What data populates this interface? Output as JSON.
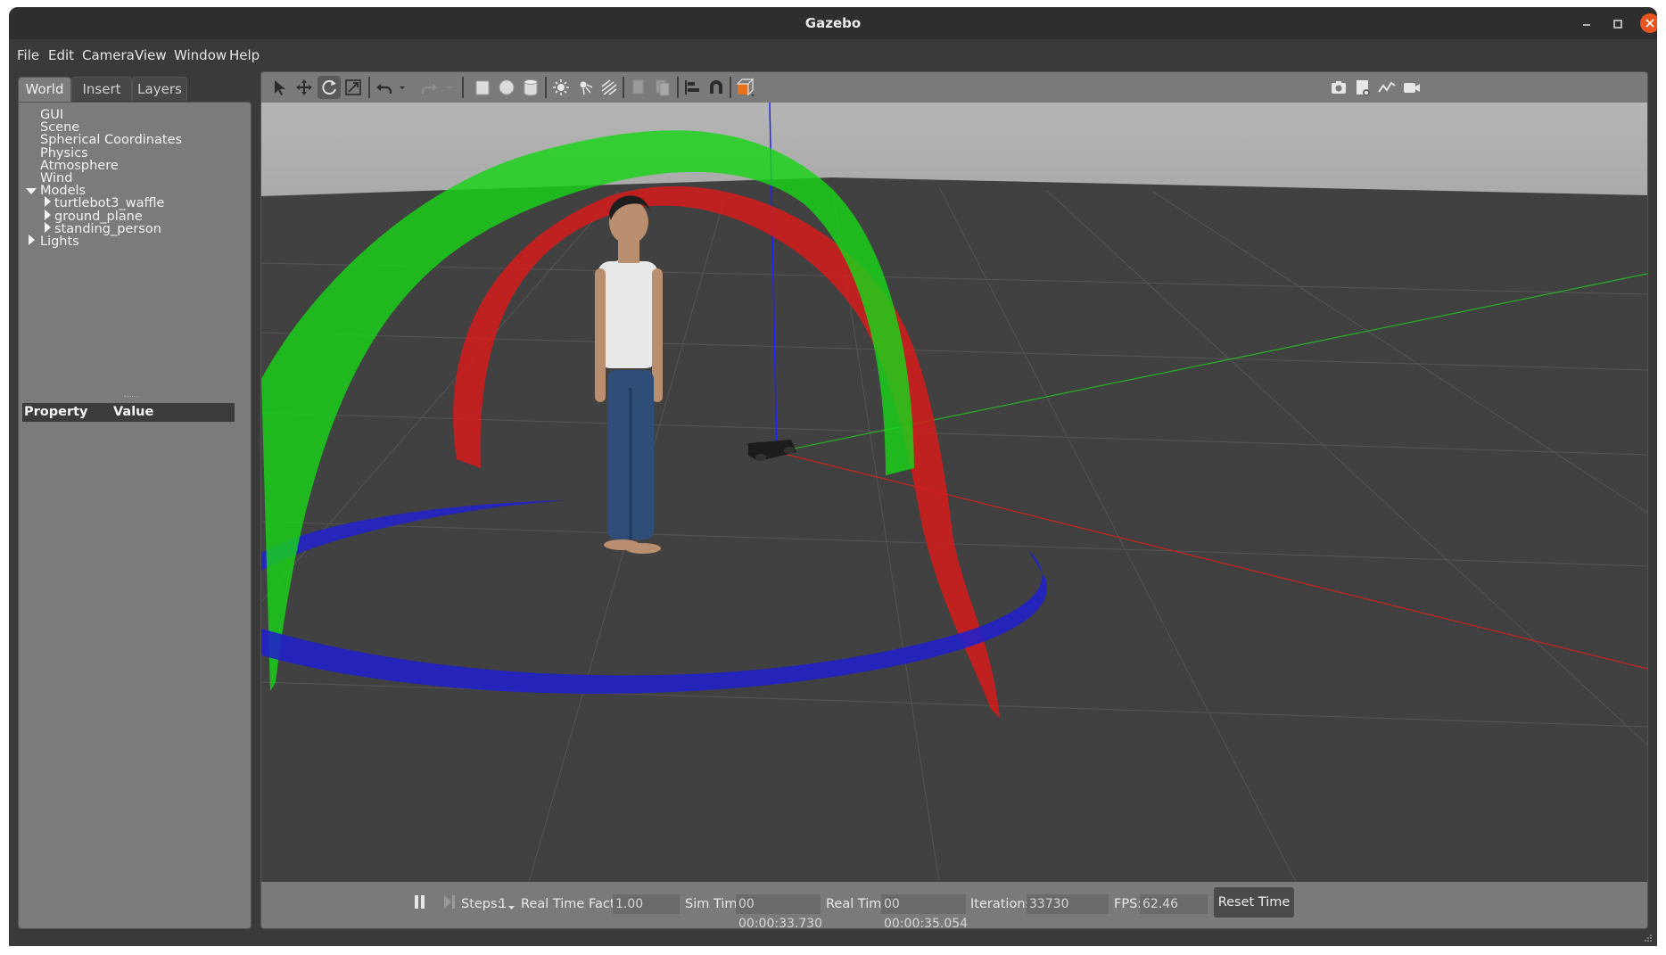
{
  "window": {
    "title": "Gazebo"
  },
  "menu": [
    "File",
    "Edit",
    "Camera",
    "View",
    "Window",
    "Help"
  ],
  "left_panel": {
    "tabs": [
      "World",
      "Insert",
      "Layers"
    ],
    "active_tab": "World",
    "tree": {
      "gui": "GUI",
      "scene": "Scene",
      "spherical": "Spherical Coordinates",
      "physics": "Physics",
      "atmosphere": "Atmosphere",
      "wind": "Wind",
      "models": "Models",
      "model_items": [
        "turtlebot3_waffle",
        "ground_plane",
        "standing_person"
      ],
      "lights": "Lights"
    },
    "property_header": {
      "property": "Property",
      "value": "Value"
    }
  },
  "toolbar": {
    "left_icons": [
      "select-arrow-icon",
      "translate-icon",
      "rotate-icon",
      "scale-icon",
      "undo-icon",
      "undo-dropdown-icon",
      "redo-icon",
      "redo-dropdown-icon",
      "box-shape-icon",
      "sphere-shape-icon",
      "cylinder-shape-icon",
      "point-light-icon",
      "spot-light-icon",
      "directional-light-icon",
      "copy-icon",
      "paste-icon",
      "align-icon",
      "snap-magnet-icon",
      "view-angle-icon"
    ],
    "right_icons": [
      "screenshot-camera-icon",
      "log-icon",
      "plot-icon",
      "video-record-icon"
    ],
    "active_tool": "rotate-icon",
    "accent": "#e8721c"
  },
  "bottom_bar": {
    "steps_label": "Steps:",
    "steps_value": "1",
    "rtf_label": "Real Time Factor:",
    "rtf_value": "1.00",
    "sim_time_label": "Sim Time:",
    "sim_time_value": "00 00:00:33.730",
    "real_time_label": "Real Time:",
    "real_time_value": "00 00:00:35.054",
    "iterations_label": "Iterations:",
    "iterations_value": "33730",
    "fps_label": "FPS:",
    "fps_value": "62.46",
    "reset_label": "Reset Time"
  },
  "scene": {
    "colors": {
      "x_ring": "#d41e1e",
      "y_ring": "#1fd11f",
      "z_ring": "#1f1fd6",
      "ground": "#3f3f3f",
      "sky": "#b3b3b3"
    }
  }
}
